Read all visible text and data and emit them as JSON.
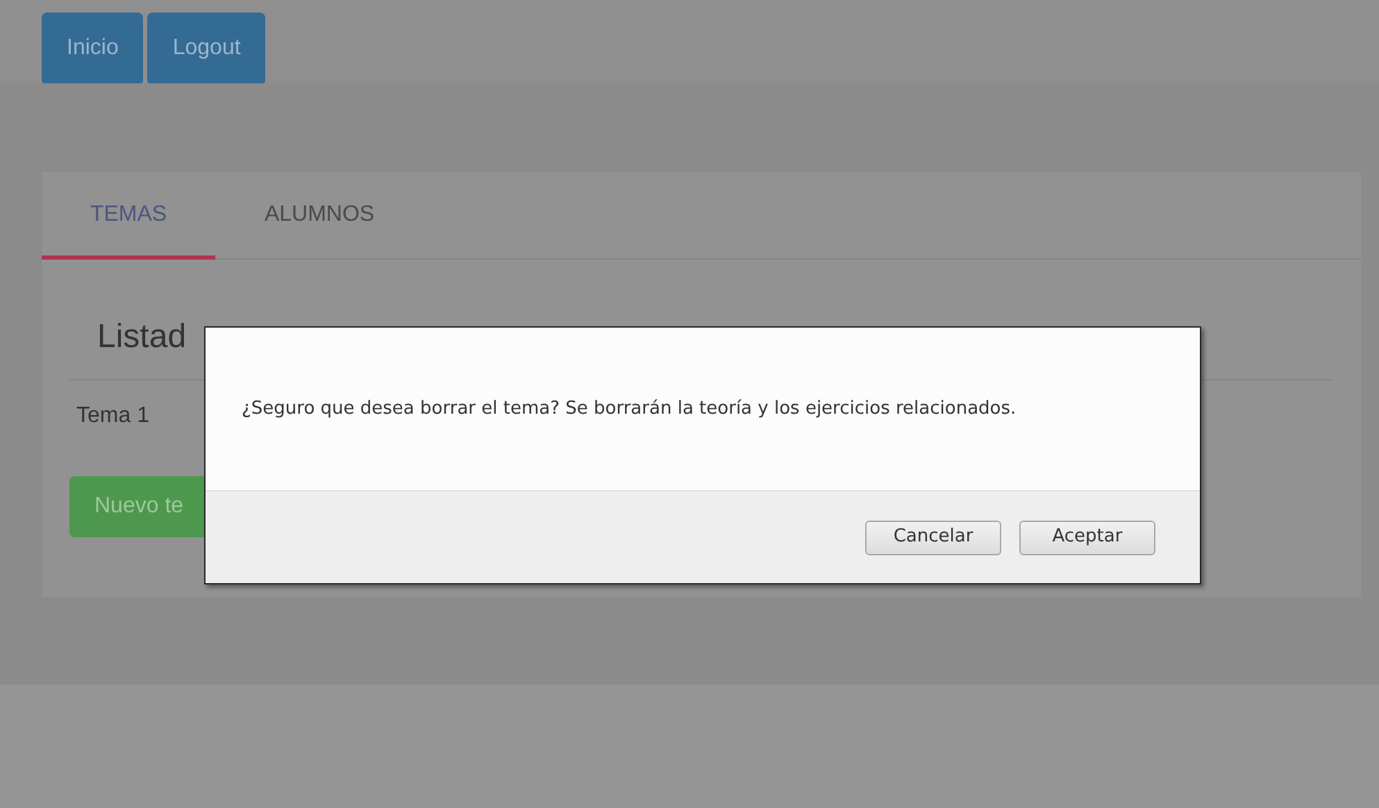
{
  "nav_buttons": [
    "Inicio",
    "Logout"
  ],
  "tabs": [
    {
      "label": "TEMAS",
      "selected": true
    },
    {
      "label": "ALUMNOS",
      "selected": false
    }
  ],
  "list": {
    "title": "Listad",
    "rows": [
      "Tema 1"
    ],
    "new_button": "Nuevo te"
  },
  "dialog": {
    "message": "¿Seguro que desea borrar el tema? Se borrarán la teoría y los ejercicios relacionados.",
    "buttons": [
      "Cancelar",
      "Aceptar"
    ]
  }
}
